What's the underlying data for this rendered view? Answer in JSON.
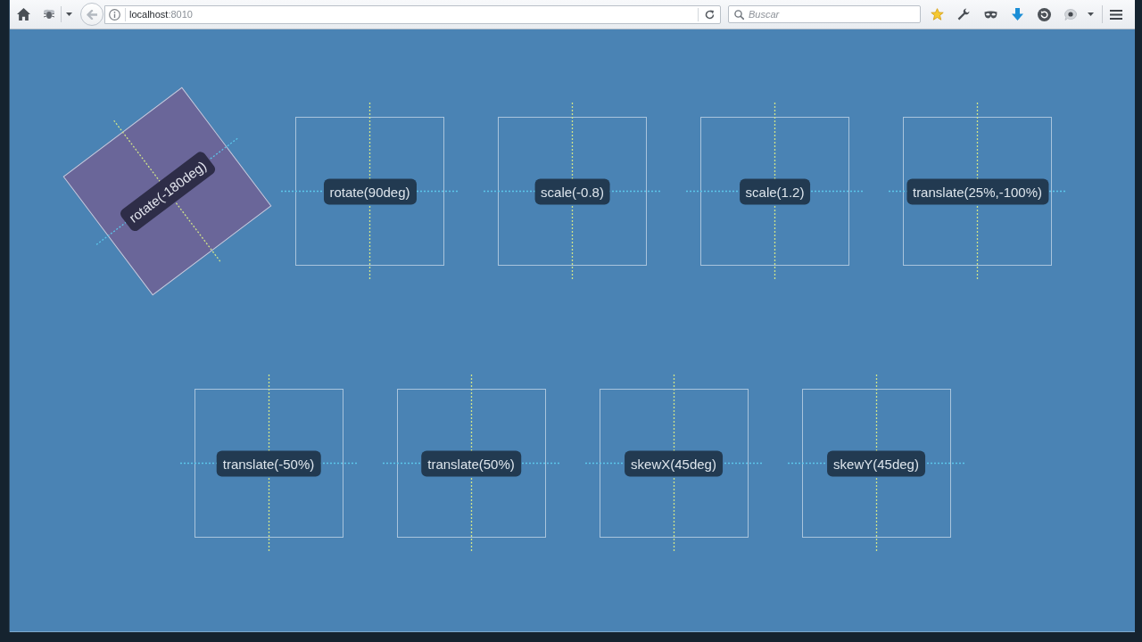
{
  "toolbar": {
    "address": {
      "host": "localhost",
      "port": ":8010"
    },
    "search": {
      "placeholder": "Buscar"
    }
  },
  "rows": [
    {
      "squares": [
        {
          "label": "rotate(-180deg)",
          "hovered": true
        },
        {
          "label": "rotate(90deg)",
          "hovered": false
        },
        {
          "label": "scale(-0.8)",
          "hovered": false
        },
        {
          "label": "scale(1.2)",
          "hovered": false
        },
        {
          "label": "translate(25%,-100%)",
          "hovered": false
        }
      ]
    },
    {
      "squares": [
        {
          "label": "translate(-50%)",
          "hovered": false
        },
        {
          "label": "translate(50%)",
          "hovered": false
        },
        {
          "label": "skewX(45deg)",
          "hovered": false
        },
        {
          "label": "skewY(45deg)",
          "hovered": false
        }
      ]
    }
  ]
}
